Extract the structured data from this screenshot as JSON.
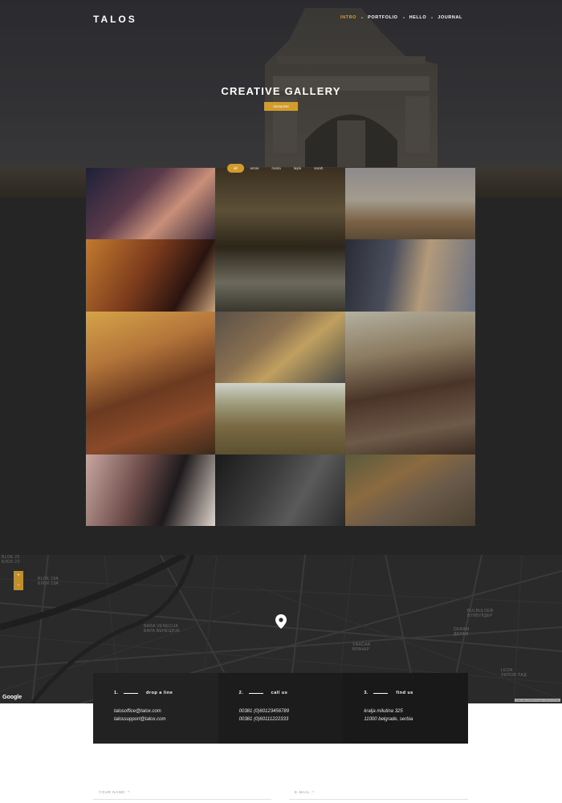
{
  "brand": {
    "logo": "TALOS"
  },
  "nav": {
    "items": [
      {
        "label": "INTRO",
        "active": true
      },
      {
        "label": "PORTFOLIO",
        "active": false
      },
      {
        "label": "HELLO",
        "active": false
      },
      {
        "label": "JOURNAL",
        "active": false
      }
    ]
  },
  "hero": {
    "title": "CREATIVE GALLERY",
    "button_label": "SEEMORE"
  },
  "gallery": {
    "filters": [
      {
        "label": "all",
        "active": true
      },
      {
        "label": "annie",
        "active": false
      },
      {
        "label": "maria",
        "active": false
      },
      {
        "label": "layla",
        "active": false
      },
      {
        "label": "sarah",
        "active": false
      }
    ]
  },
  "map": {
    "labels": [
      "BLOK 23",
      "БЛОК 23",
      "BLOK 19A",
      "БЛОК 19А",
      "BARA VENECIJA",
      "БАРА ВЕНЕЦИЈА",
      "VRAČAR",
      "ВРАЧАР",
      "BULBULDER",
      "БУЛБУЛДЕР",
      "DERAM",
      "ДЕРАМ",
      "LEON",
      "ЛИПОВ ЛАД"
    ],
    "attribution": "Google",
    "credit": "Map data ©2016 Google | Terms of Use",
    "zoom_in": "+",
    "zoom_out": "−"
  },
  "contact": [
    {
      "number": "1.",
      "title": "drop a line",
      "lines": [
        "talosoffice@talox.com",
        "talossupport@talox.com"
      ]
    },
    {
      "number": "2.",
      "title": "call us",
      "lines": [
        "00381 (0)60123456789",
        "00381 (0)60111222333"
      ]
    },
    {
      "number": "3.",
      "title": "find us",
      "lines": [
        "kralja milutina 325",
        "11000 belgrade, serbia"
      ]
    }
  ],
  "form": {
    "name_label": "YOUR NAME: *",
    "email_label": "E-MAIL: *"
  },
  "colors": {
    "accent": "#d29c2c",
    "dark_bg": "#252525",
    "map_bg": "#2a2a2a"
  }
}
